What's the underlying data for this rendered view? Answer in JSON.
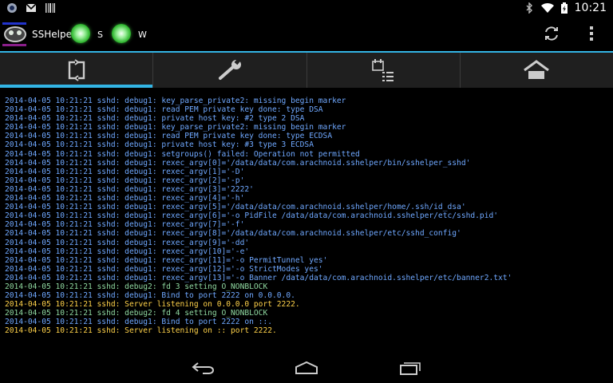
{
  "status_bar": {
    "time": "10:21",
    "left_icons": [
      "notification-icon",
      "gmail-icon",
      "barcode-icon"
    ],
    "right_icons": [
      "bluetooth-icon",
      "wifi-icon",
      "battery-icon"
    ]
  },
  "action_bar": {
    "title": "SSHelper",
    "indicators": [
      {
        "label": "S",
        "status": "on"
      },
      {
        "label": "W",
        "status": "on"
      }
    ],
    "actions": [
      "refresh-icon",
      "overflow-menu-icon"
    ]
  },
  "tabs": [
    {
      "icon": "log-icon",
      "active": true
    },
    {
      "icon": "wrench-icon",
      "active": false
    },
    {
      "icon": "schedule-list-icon",
      "active": false
    },
    {
      "icon": "home-icon",
      "active": false
    }
  ],
  "log": [
    {
      "level": "debug1",
      "text": "2014-04-05 10:21:21 sshd: debug1: key_parse_private2: missing begin marker"
    },
    {
      "level": "debug1",
      "text": "2014-04-05 10:21:21 sshd: debug1: read PEM private key done: type DSA"
    },
    {
      "level": "debug1",
      "text": "2014-04-05 10:21:21 sshd: debug1: private host key: #2 type 2 DSA"
    },
    {
      "level": "debug1",
      "text": "2014-04-05 10:21:21 sshd: debug1: key_parse_private2: missing begin marker"
    },
    {
      "level": "debug1",
      "text": "2014-04-05 10:21:21 sshd: debug1: read PEM private key done: type ECDSA"
    },
    {
      "level": "debug1",
      "text": "2014-04-05 10:21:21 sshd: debug1: private host key: #3 type 3 ECDSA"
    },
    {
      "level": "debug1",
      "text": "2014-04-05 10:21:21 sshd: debug1: setgroups() failed: Operation not permitted"
    },
    {
      "level": "debug1",
      "text": "2014-04-05 10:21:21 sshd: debug1: rexec_argv[0]='/data/data/com.arachnoid.sshelper/bin/sshelper_sshd'"
    },
    {
      "level": "debug1",
      "text": "2014-04-05 10:21:21 sshd: debug1: rexec_argv[1]='-D'"
    },
    {
      "level": "debug1",
      "text": "2014-04-05 10:21:21 sshd: debug1: rexec_argv[2]='-p'"
    },
    {
      "level": "debug1",
      "text": "2014-04-05 10:21:21 sshd: debug1: rexec_argv[3]='2222'"
    },
    {
      "level": "debug1",
      "text": "2014-04-05 10:21:21 sshd: debug1: rexec_argv[4]='-h'"
    },
    {
      "level": "debug1",
      "text": "2014-04-05 10:21:21 sshd: debug1: rexec_argv[5]='/data/data/com.arachnoid.sshelper/home/.ssh/id_dsa'"
    },
    {
      "level": "debug1",
      "text": "2014-04-05 10:21:21 sshd: debug1: rexec_argv[6]='-o PidFile /data/data/com.arachnoid.sshelper/etc/sshd.pid'"
    },
    {
      "level": "debug1",
      "text": "2014-04-05 10:21:21 sshd: debug1: rexec_argv[7]='-f'"
    },
    {
      "level": "debug1",
      "text": "2014-04-05 10:21:21 sshd: debug1: rexec_argv[8]='/data/data/com.arachnoid.sshelper/etc/sshd_config'"
    },
    {
      "level": "debug1",
      "text": "2014-04-05 10:21:21 sshd: debug1: rexec_argv[9]='-dd'"
    },
    {
      "level": "debug1",
      "text": "2014-04-05 10:21:21 sshd: debug1: rexec_argv[10]='-e'"
    },
    {
      "level": "debug1",
      "text": "2014-04-05 10:21:21 sshd: debug1: rexec_argv[11]='-o PermitTunnel yes'"
    },
    {
      "level": "debug1",
      "text": "2014-04-05 10:21:21 sshd: debug1: rexec_argv[12]='-o StrictModes yes'"
    },
    {
      "level": "debug1",
      "text": "2014-04-05 10:21:21 sshd: debug1: rexec_argv[13]='-o Banner /data/data/com.arachnoid.sshelper/etc/banner2.txt'"
    },
    {
      "level": "debug2",
      "text": "2014-04-05 10:21:21 sshd: debug2: fd 3 setting O_NONBLOCK"
    },
    {
      "level": "debug1",
      "text": "2014-04-05 10:21:21 sshd: debug1: Bind to port 2222 on 0.0.0.0."
    },
    {
      "level": "info",
      "text": "2014-04-05 10:21:21 sshd: Server listening on 0.0.0.0 port 2222."
    },
    {
      "level": "debug2",
      "text": "2014-04-05 10:21:21 sshd: debug2: fd 4 setting O_NONBLOCK"
    },
    {
      "level": "debug1",
      "text": "2014-04-05 10:21:21 sshd: debug1: Bind to port 2222 on ::."
    },
    {
      "level": "info",
      "text": "2014-04-05 10:21:21 sshd: Server listening on :: port 2222."
    }
  ],
  "nav_bar": [
    "back-icon",
    "home-nav-icon",
    "recent-apps-icon"
  ],
  "colors": {
    "accent": "#33b5e5",
    "debug1": "#6fa8ff",
    "debug2": "#8fd8a0",
    "info": "#ffd24a"
  }
}
